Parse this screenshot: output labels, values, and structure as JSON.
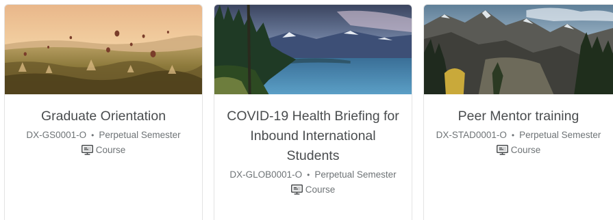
{
  "cards": [
    {
      "title": "Graduate Orientation",
      "code": "DX-GS0001-O",
      "separator": "•",
      "semester": "Perpetual Semester",
      "type_label": "Course",
      "image_icon": "hot-air-balloons-landscape-image"
    },
    {
      "title": "COVID-19 Health Briefing for Inbound International Students",
      "code": "DX-GLOB0001-O",
      "separator": "•",
      "semester": "Perpetual Semester",
      "type_label": "Course",
      "image_icon": "lake-forest-mountains-image"
    },
    {
      "title": "Peer Mentor training",
      "code": "DX-STAD0001-O",
      "separator": "•",
      "semester": "Perpetual Semester",
      "type_label": "Course",
      "image_icon": "mountain-valley-image"
    }
  ],
  "type_icon": "course-presentation-icon",
  "colors": {
    "title": "#494c4e",
    "meta": "#6e7376",
    "border": "#e3e3e3"
  }
}
